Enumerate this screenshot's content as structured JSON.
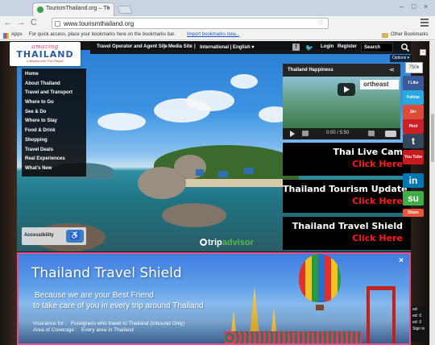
{
  "browser": {
    "tab_title": "TourismThailand.org – Th",
    "tab_close": "×",
    "url": "www.tourismthailand.org",
    "nav": {
      "back": "←",
      "forward": "→",
      "reload": "C"
    },
    "star": "☆",
    "bookmarks": {
      "apps": "Apps",
      "hint": "For quick access, place your bookmarks here on the bookmarks bar.",
      "import_link": "Import bookmarks now...",
      "other": "Other Bookmarks"
    },
    "window_controls": {
      "minimize": "–",
      "maximize": "□",
      "close": "×"
    }
  },
  "site": {
    "logo": {
      "amazing": "amazing",
      "thailand": "THAILAND",
      "tagline": "It Begins with The People"
    },
    "topnav": {
      "items": [
        "Travel Operator and Agent Site",
        "|",
        "Media Site",
        "|",
        "International | English ▾"
      ],
      "facebook": "f",
      "login": "Login",
      "register": "Register",
      "search_label": "Search",
      "options": "Options ▾"
    },
    "menu": [
      "Home",
      "About Thailand",
      "Travel and Transport",
      "Where to Go",
      "See & Do",
      "Where to Stay",
      "Food & Drink",
      "Shopping",
      "Travel Deals",
      "Real Experiences",
      "What's New"
    ],
    "accessibility": {
      "label": "Accessibility"
    },
    "tripadvisor": {
      "trip": "trip",
      "advisor": "advisor"
    },
    "video": {
      "title": "Thailand Happiness",
      "banner": "ortheast",
      "time": "0:00 / 5:50"
    },
    "promos": [
      {
        "title": "Thai Live Cam",
        "cta": "Click Here"
      },
      {
        "title": "Thailand Tourism Update",
        "cta": "Click Here"
      },
      {
        "title": "Thailand Travel Shield",
        "cta": "Click Here"
      }
    ],
    "social": {
      "count": "750k",
      "fb_like": "f Like",
      "tw_follow": "Follow",
      "gplus_count": "1k+",
      "pinterest": "Pinit",
      "share": "Share",
      "colors": {
        "facebook": "#3b5998",
        "twitter": "#2aa9e0",
        "google": "#dd4b39",
        "pinterest": "#cb2027",
        "tumblr": "#35465c",
        "youtube": "#cc181e",
        "linkedin": "#0077b5",
        "stumble": "#3fae46",
        "share": "#e8553a"
      }
    },
    "shield_banner": {
      "title": "Thailand Travel Shield",
      "sub1": "Because we are your Best Friend",
      "sub2": "to take care of you in every trip around Thailand",
      "insurance_label": "Insurance for :",
      "insurance_value": "Foreigners who travel to Thailand (Inbound Only)",
      "area_label": "Area of Coverage :",
      "area_value": "Every area in Thailand",
      "close": "×"
    },
    "side_widget": {
      "line1": "ed:",
      "line2": "ed: 0",
      "line3": "ed: 0",
      "line4": "Sign in"
    }
  },
  "accent_colors": {
    "promo_cta": "#ff1a1a",
    "shield_border": "#e94d8c",
    "logo_pink": "#e0306b",
    "logo_blue": "#2a5aa8"
  }
}
